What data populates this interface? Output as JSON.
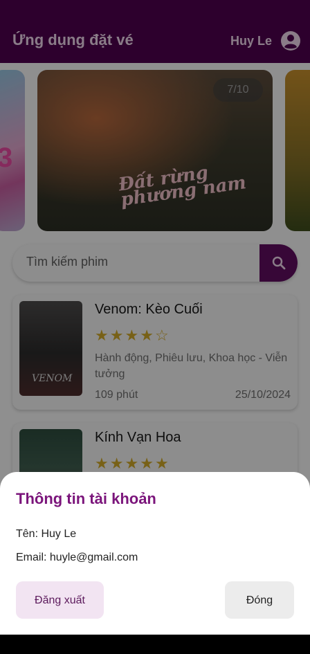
{
  "app_bar": {
    "title": "Ứng dụng đặt vé",
    "user_name": "Huy Le"
  },
  "carousel": {
    "counter": "7/10",
    "poster_text": "Đất rừng phương nam",
    "left_text": "3"
  },
  "search": {
    "placeholder": "Tìm kiếm phim"
  },
  "movies": [
    {
      "title": "Venom: Kèo Cuối",
      "rating": 4,
      "max_rating": 5,
      "genre": "Hành động, Phiêu lưu, Khoa học - Viễn tưởng",
      "duration": "109 phút",
      "release_date": "25/10/2024",
      "poster_text": "VENOM"
    },
    {
      "title": "Kính Vạn Hoa",
      "rating": 5,
      "max_rating": 5
    }
  ],
  "account_sheet": {
    "title": "Thông tin tài khoản",
    "name_line": "Tên: Huy Le",
    "email_line": "Email:  huyle@gmail.com",
    "logout_label": "Đăng xuất",
    "close_label": "Đóng"
  },
  "colors": {
    "primary": "#4c004c",
    "accent": "#7b157b",
    "star": "#c9a227"
  }
}
